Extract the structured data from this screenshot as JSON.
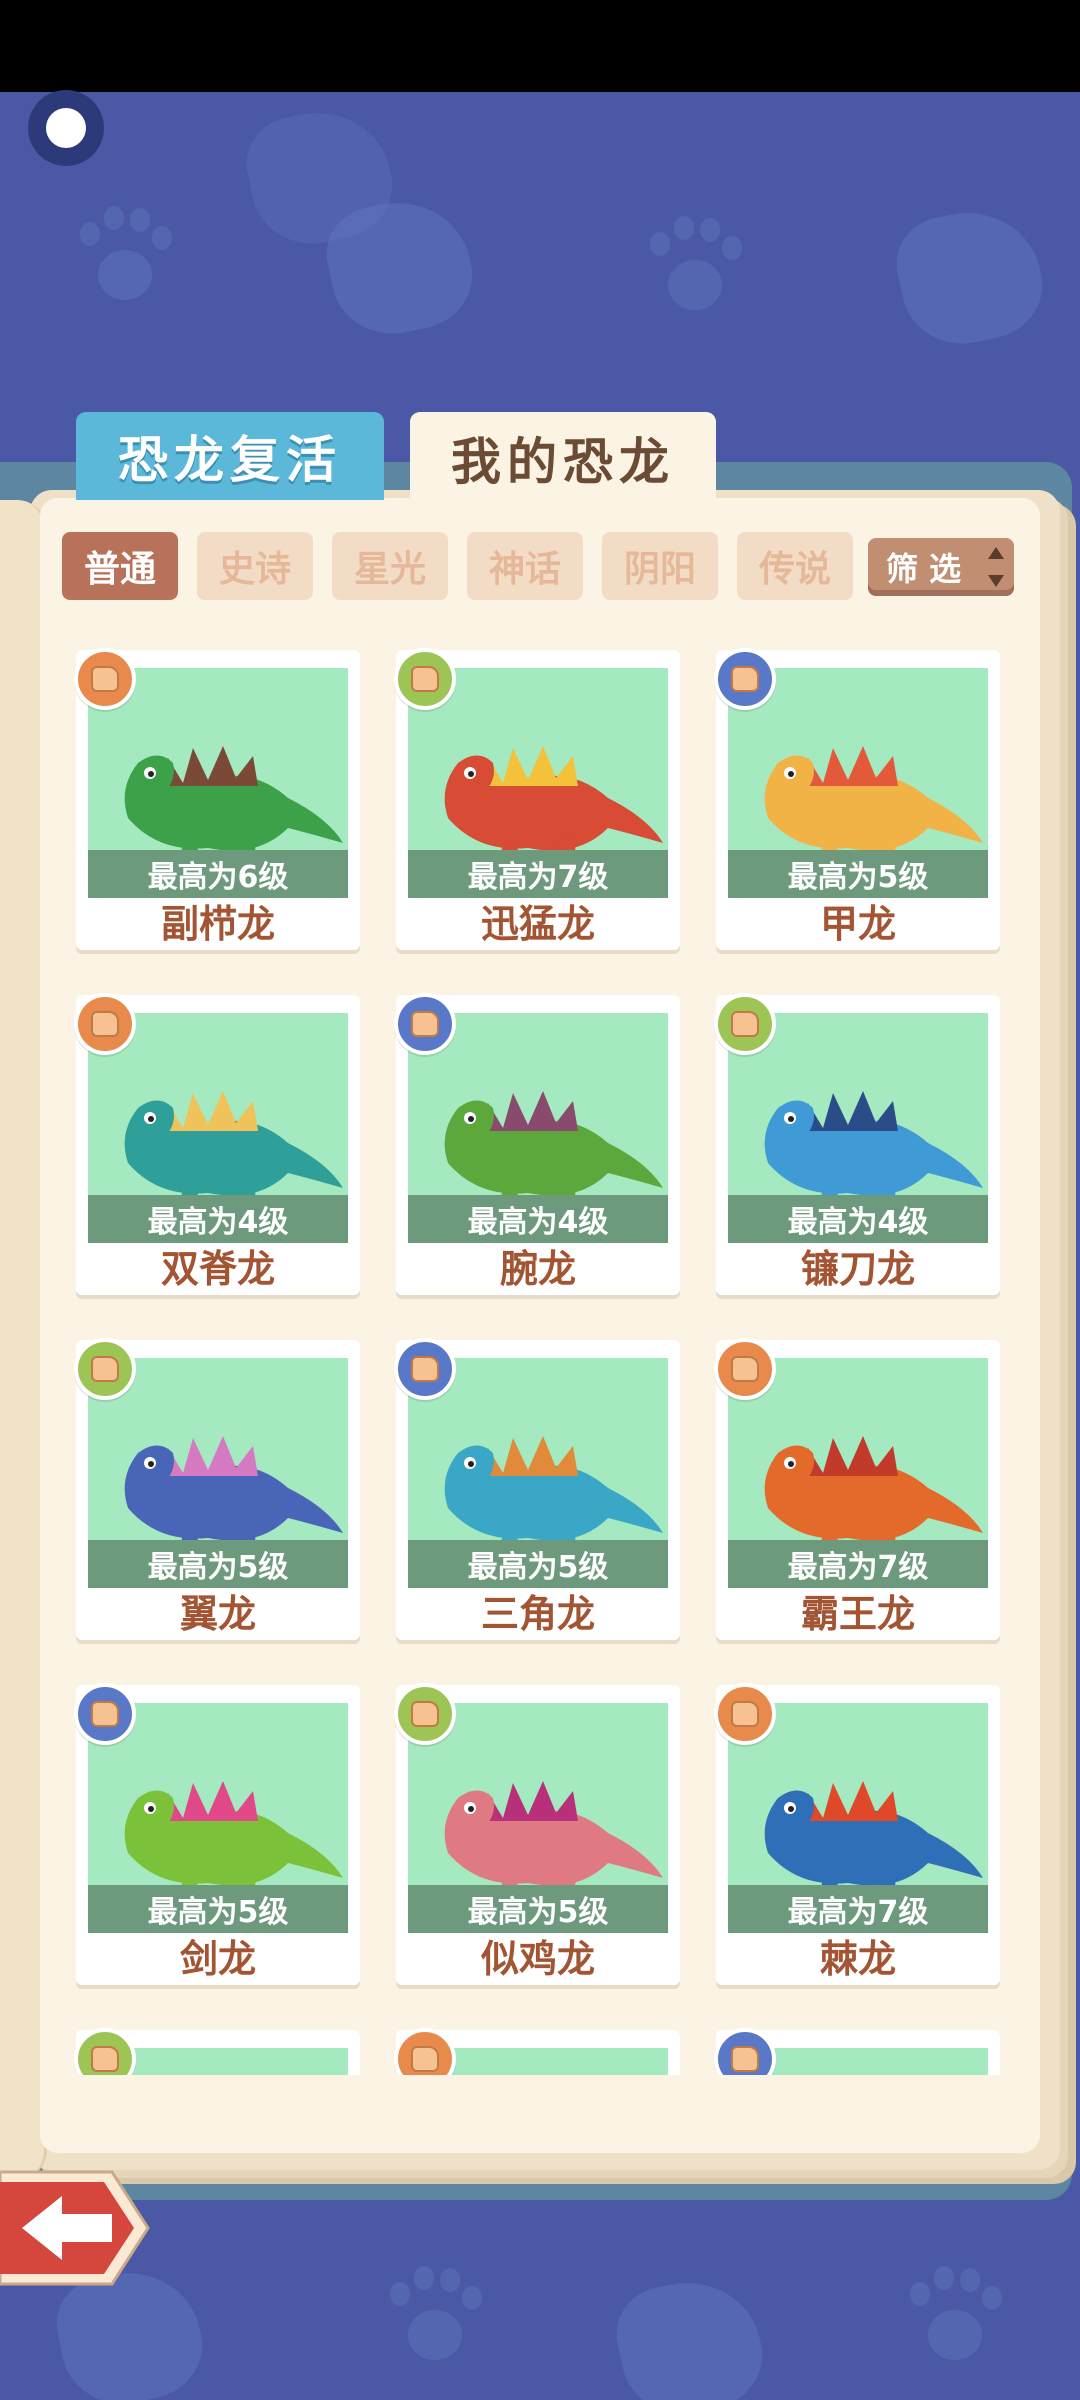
{
  "colors": {
    "background": "#4b58a6",
    "page": "#fbf3e4",
    "tab_revive": "#5bb8d8",
    "art_bg": "#a5e9c1",
    "level_bar": "#6d9a7c",
    "name_text": "#a25433",
    "badge_orange": "#e88a4c",
    "badge_green": "#9cc555",
    "badge_blue": "#5a78c8"
  },
  "tabs": {
    "revive": "恐龙复活",
    "mine": "我的恐龙"
  },
  "filters": {
    "chips": [
      "普通",
      "史诗",
      "星光",
      "神话",
      "阴阳",
      "传说"
    ],
    "active": "普通",
    "filter_label": "筛 选"
  },
  "dinosaurs": [
    {
      "name": "副栉龙",
      "level": "最高为6级",
      "badge": "orange",
      "body": "#3da14a",
      "accent": "#7a4a36"
    },
    {
      "name": "迅猛龙",
      "level": "最高为7级",
      "badge": "green",
      "body": "#d84b34",
      "accent": "#f3c23a"
    },
    {
      "name": "甲龙",
      "level": "最高为5级",
      "badge": "blue",
      "body": "#f2b346",
      "accent": "#e35a3a"
    },
    {
      "name": "双脊龙",
      "level": "最高为4级",
      "badge": "orange",
      "body": "#2f9f9a",
      "accent": "#f0c35a"
    },
    {
      "name": "腕龙",
      "level": "最高为4级",
      "badge": "blue",
      "body": "#5ca83c",
      "accent": "#8a4a6e"
    },
    {
      "name": "镰刀龙",
      "level": "最高为4级",
      "badge": "green",
      "body": "#3f9ad6",
      "accent": "#2a4d8a"
    },
    {
      "name": "翼龙",
      "level": "最高为5级",
      "badge": "green",
      "body": "#4865b8",
      "accent": "#d57ac2"
    },
    {
      "name": "三角龙",
      "level": "最高为5级",
      "badge": "blue",
      "body": "#3ba7c6",
      "accent": "#e08a3a"
    },
    {
      "name": "霸王龙",
      "level": "最高为7级",
      "badge": "orange",
      "body": "#e46a2c",
      "accent": "#c23a2a"
    },
    {
      "name": "剑龙",
      "level": "最高为5级",
      "badge": "blue",
      "body": "#7bc23a",
      "accent": "#e0488a"
    },
    {
      "name": "似鸡龙",
      "level": "最高为5级",
      "badge": "green",
      "body": "#e07a82",
      "accent": "#b8307a"
    },
    {
      "name": "棘龙",
      "level": "最高为7级",
      "badge": "orange",
      "body": "#2f6fb8",
      "accent": "#e0482a"
    }
  ],
  "partial_row_badges": [
    "green",
    "orange",
    "blue"
  ]
}
